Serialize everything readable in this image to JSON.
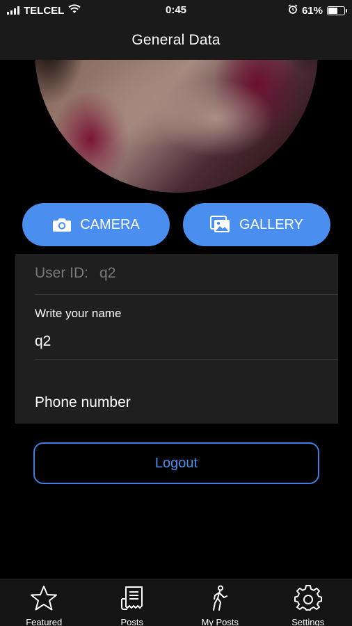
{
  "status_bar": {
    "carrier": "TELCEL",
    "time": "0:45",
    "battery_percent": "61%",
    "battery_level": 0.61
  },
  "nav": {
    "title": "General Data"
  },
  "buttons": {
    "camera_label": "CAMERA",
    "gallery_label": "GALLERY",
    "accent_color": "#4a8ef0"
  },
  "form": {
    "user_id_label": "User ID:",
    "user_id_value": "q2",
    "name_label": "Write your name",
    "name_value": "q2",
    "phone_placeholder": "Phone number"
  },
  "logout_label": "Logout",
  "tabs": [
    {
      "label": "Featured",
      "icon": "star-icon"
    },
    {
      "label": "Posts",
      "icon": "receipt-icon"
    },
    {
      "label": "My Posts",
      "icon": "walking-person-icon"
    },
    {
      "label": "Settings",
      "icon": "gear-icon"
    }
  ]
}
